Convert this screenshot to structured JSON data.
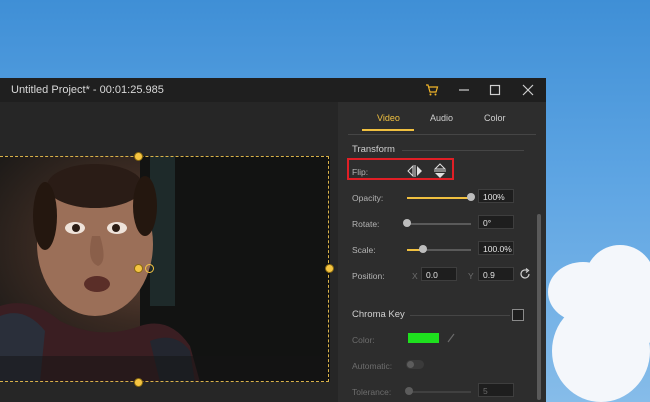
{
  "window": {
    "title": "Untitled Project* - 00:01:25.985"
  },
  "titlebar_icons": [
    "cart-icon",
    "minimize-icon",
    "maximize-icon",
    "close-icon"
  ],
  "tabs": [
    {
      "label": "Video",
      "active": true
    },
    {
      "label": "Audio",
      "active": false
    },
    {
      "label": "Color",
      "active": false
    }
  ],
  "transform": {
    "heading": "Transform",
    "flip_label": "Flip:",
    "opacity": {
      "label": "Opacity:",
      "value": "100%",
      "level": 1.0
    },
    "rotate": {
      "label": "Rotate:",
      "value": "0°",
      "level": 0.0
    },
    "scale": {
      "label": "Scale:",
      "value": "100.0%",
      "level": 0.25
    },
    "position": {
      "label": "Position:",
      "x_label": "X",
      "x_value": "0.0",
      "y_label": "Y",
      "y_value": "0.9"
    }
  },
  "chroma_key": {
    "heading": "Chroma Key",
    "color_label": "Color:",
    "color_value": "#1ee01e",
    "automatic_label": "Automatic:",
    "tolerance_label": "Tolerance:",
    "tolerance_value": "5"
  },
  "colors": {
    "accent": "#f0c040",
    "highlight_box": "#e01f26"
  }
}
